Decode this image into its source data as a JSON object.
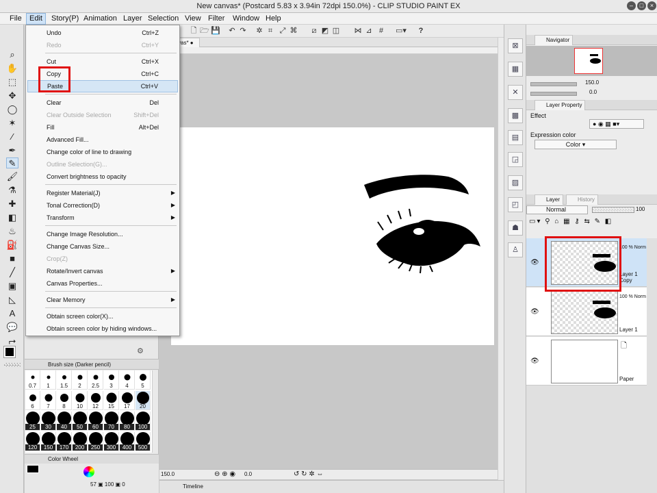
{
  "window": {
    "title": "New canvas* (Postcard 5.83 x 3.94in 72dpi 150.0%) - CLIP STUDIO PAINT EX"
  },
  "menubar": [
    "File",
    "Edit",
    "Story(P)",
    "Animation",
    "Layer",
    "Selection",
    "View",
    "Filter",
    "Window",
    "Help"
  ],
  "edit_menu": {
    "items": [
      {
        "label": "Undo",
        "shortcut": "Ctrl+Z",
        "disabled": false
      },
      {
        "label": "Redo",
        "shortcut": "Ctrl+Y",
        "disabled": true
      },
      {
        "label": "Cut",
        "shortcut": "Ctrl+X",
        "disabled": false
      },
      {
        "label": "Copy",
        "shortcut": "Ctrl+C",
        "disabled": false
      },
      {
        "label": "Paste",
        "shortcut": "Ctrl+V",
        "disabled": false
      },
      {
        "label": "Clear",
        "shortcut": "Del",
        "disabled": false
      },
      {
        "label": "Clear Outside Selection",
        "shortcut": "Shift+Del",
        "disabled": true
      },
      {
        "label": "Fill",
        "shortcut": "Alt+Del",
        "disabled": false
      },
      {
        "label": "Advanced Fill...",
        "shortcut": "",
        "disabled": false
      },
      {
        "label": "Change color of line to drawing",
        "shortcut": "",
        "disabled": false
      },
      {
        "label": "Outline Selection(G)...",
        "shortcut": "",
        "disabled": true
      },
      {
        "label": "Convert brightness to opacity",
        "shortcut": "",
        "disabled": false
      },
      {
        "label": "Register Material(J)",
        "shortcut": "",
        "disabled": false,
        "submenu": true
      },
      {
        "label": "Tonal Correction(D)",
        "shortcut": "",
        "disabled": false,
        "submenu": true
      },
      {
        "label": "Transform",
        "shortcut": "",
        "disabled": false,
        "submenu": true
      },
      {
        "label": "Change Image Resolution...",
        "shortcut": "",
        "disabled": false
      },
      {
        "label": "Change Canvas Size...",
        "shortcut": "",
        "disabled": false
      },
      {
        "label": "Crop(Z)",
        "shortcut": "",
        "disabled": true
      },
      {
        "label": "Rotate/Invert canvas",
        "shortcut": "",
        "disabled": false,
        "submenu": true
      },
      {
        "label": "Canvas Properties...",
        "shortcut": "",
        "disabled": false
      },
      {
        "label": "Clear Memory",
        "shortcut": "",
        "disabled": false,
        "submenu": true
      },
      {
        "label": "Obtain screen color(X)...",
        "shortcut": "",
        "disabled": false
      },
      {
        "label": "Obtain screen color by hiding windows...",
        "shortcut": "",
        "disabled": false
      }
    ],
    "highlighted": "Paste",
    "annotated": [
      "Copy",
      "Paste"
    ]
  },
  "canvas": {
    "tab_label": "vas*",
    "zoom": "150.0",
    "angle": "0.0"
  },
  "brush_size": {
    "title": "Brush size (Darker pencil)",
    "sizes": [
      "0.7",
      "1",
      "1.5",
      "2",
      "2.5",
      "3",
      "4",
      "5",
      "6",
      "7",
      "8",
      "10",
      "12",
      "15",
      "17",
      "20",
      "25",
      "30",
      "40",
      "50",
      "60",
      "70",
      "80",
      "100",
      "120",
      "150",
      "170",
      "200",
      "250",
      "300",
      "400",
      "500"
    ],
    "selected": "20"
  },
  "color_panel": {
    "title": "Color Wheel",
    "readout": "57",
    "readout2": "100",
    "readout3": "0"
  },
  "timeline": {
    "label": "Timeline"
  },
  "navigator": {
    "title": "Navigator",
    "zoom": "150.0",
    "angle": "0.0"
  },
  "layer_property": {
    "title": "Layer Property",
    "effect_label": "Effect",
    "expression_color_label": "Expression color",
    "expression_color_value": "Color"
  },
  "layer_panel": {
    "tabs": [
      "Layer",
      "History"
    ],
    "blend_mode": "Normal",
    "opacity": "100",
    "layers": [
      {
        "name": "Layer 1 Copy",
        "blend": "100 % Norm",
        "selected": true
      },
      {
        "name": "Layer 1",
        "blend": "100 % Norm",
        "selected": false
      },
      {
        "name": "Paper",
        "blend": "",
        "selected": false
      }
    ]
  },
  "colors": {
    "annotation": "#e01010",
    "selection_highlight": "#d5e6f5"
  }
}
